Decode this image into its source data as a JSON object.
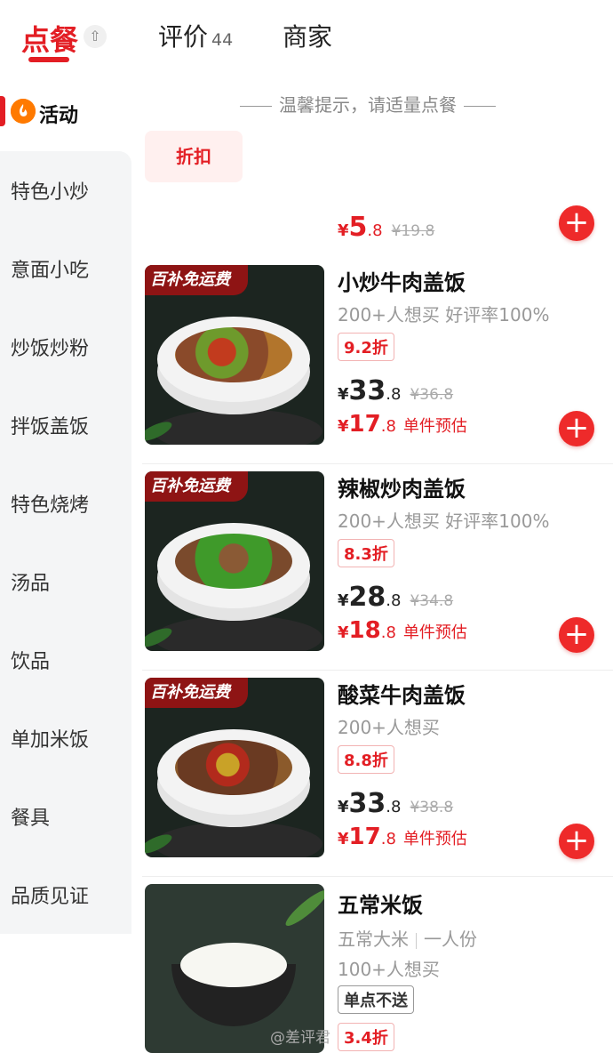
{
  "tabs": {
    "order": "点餐",
    "collapse_icon": "⇧",
    "reviews": "评价",
    "reviews_count": "44",
    "merchant": "商家"
  },
  "sidebar": {
    "active": {
      "icon": "flame-icon",
      "label": "活动"
    },
    "items": [
      "特色小炒",
      "意面小吃",
      "炒饭炒粉",
      "拌饭盖饭",
      "特色烧烤",
      "汤品",
      "饮品",
      "单加米饭",
      "餐具",
      "品质见证"
    ]
  },
  "tip": "温馨提示，请适量点餐",
  "promo": {
    "chip": "折扣",
    "currency": "¥",
    "price_int": "5",
    "price_dec": ".8",
    "orig": "¥19.8"
  },
  "items": [
    {
      "ribbon": "百补免运费",
      "name": "小炒牛肉盖饭",
      "meta": "200+人想买 好评率100%",
      "discount": "9.2折",
      "currency": "¥",
      "price_int": "33",
      "price_dec": ".8",
      "orig": "¥36.8",
      "est_int": "17",
      "est_dec": ".8",
      "est_label": "单件预估"
    },
    {
      "ribbon": "百补免运费",
      "name": "辣椒炒肉盖饭",
      "meta": "200+人想买 好评率100%",
      "discount": "8.3折",
      "currency": "¥",
      "price_int": "28",
      "price_dec": ".8",
      "orig": "¥34.8",
      "est_int": "18",
      "est_dec": ".8",
      "est_label": "单件预估"
    },
    {
      "ribbon": "百补免运费",
      "name": "酸菜牛肉盖饭",
      "meta": "200+人想买",
      "discount": "8.8折",
      "currency": "¥",
      "price_int": "33",
      "price_dec": ".8",
      "orig": "¥38.8",
      "est_int": "17",
      "est_dec": ".8",
      "est_label": "单件预估"
    }
  ],
  "rice": {
    "name": "五常米饭",
    "spec_a": "五常大米",
    "spec_b": "一人份",
    "want": "100+人想买",
    "tag": "单点不送",
    "discount": "3.4折"
  },
  "add_icon": "+",
  "watermark": "@差评君",
  "colors": {
    "accent": "#e31e24",
    "sidebar_bg": "#f4f5f6",
    "ribbon": "#8e1414"
  }
}
